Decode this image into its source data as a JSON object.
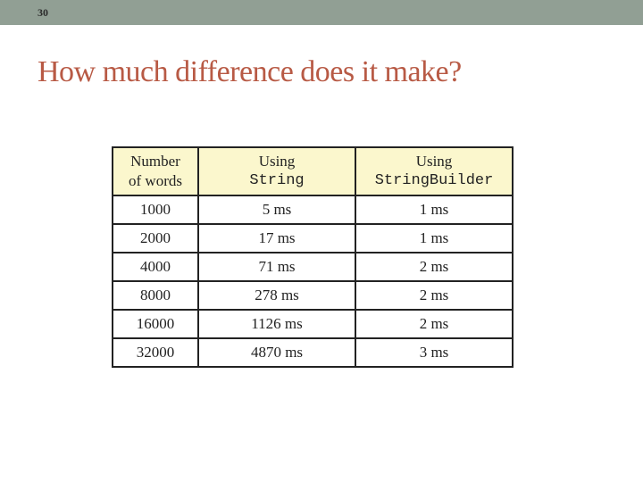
{
  "slide": {
    "number": "30",
    "title": "How much difference does it make?"
  },
  "table": {
    "headers": [
      {
        "line1": "Number",
        "line2": "of words"
      },
      {
        "line1": "Using",
        "line2": "String"
      },
      {
        "line1": "Using",
        "line2": "StringBuilder"
      }
    ],
    "rows": [
      [
        "1000",
        "5 ms",
        "1 ms"
      ],
      [
        "2000",
        "17 ms",
        "1 ms"
      ],
      [
        "4000",
        "71 ms",
        "2 ms"
      ],
      [
        "8000",
        "278 ms",
        "2 ms"
      ],
      [
        "16000",
        "1126 ms",
        "2 ms"
      ],
      [
        "32000",
        "4870 ms",
        "3 ms"
      ]
    ]
  },
  "colors": {
    "topbar": "#919f94",
    "title": "#b85a45",
    "header_bg": "#fbf7cd"
  }
}
